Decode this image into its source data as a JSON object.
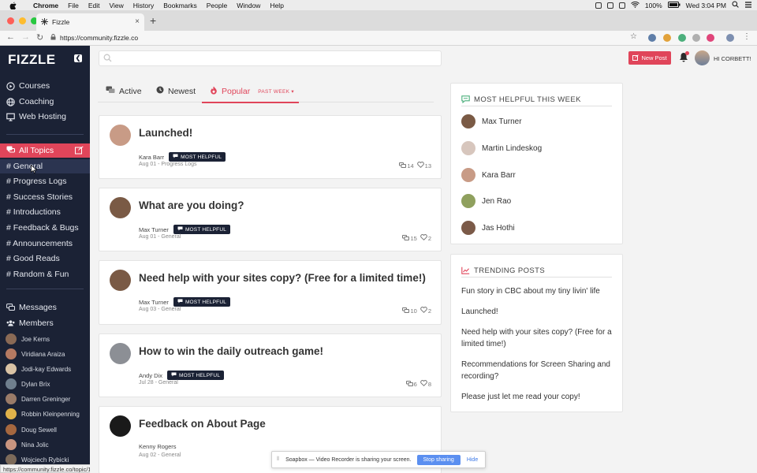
{
  "mac_menu": {
    "app": "Chrome",
    "items": [
      "File",
      "Edit",
      "View",
      "History",
      "Bookmarks",
      "People",
      "Window",
      "Help"
    ],
    "battery": "100%",
    "clock": "Wed 3:04 PM"
  },
  "browser": {
    "tab_title": "Fizzle",
    "url": "https://community.fizzle.co",
    "status_url": "https://community.fizzle.co/topic/1"
  },
  "sidebar": {
    "logo": "FIZZLE",
    "nav": [
      {
        "label": "Courses",
        "icon": "play-circle-icon"
      },
      {
        "label": "Coaching",
        "icon": "globe-icon"
      },
      {
        "label": "Web Hosting",
        "icon": "monitor-icon"
      }
    ],
    "all_topics": "All Topics",
    "topics": [
      "# General",
      "# Progress Logs",
      "# Success Stories",
      "# Introductions",
      "# Feedback & Bugs",
      "# Announcements",
      "# Good Reads",
      "# Random & Fun"
    ],
    "messages": "Messages",
    "members_label": "Members",
    "members": [
      {
        "name": "Joe Kerns",
        "color": "#8a6a55"
      },
      {
        "name": "Viridiana Araiza",
        "color": "#b57a62"
      },
      {
        "name": "Jodi-kay Edwards",
        "color": "#d9c3a5"
      },
      {
        "name": "Dylan Brix",
        "color": "#6f7f8e"
      },
      {
        "name": "Darren Greninger",
        "color": "#9a7b68"
      },
      {
        "name": "Robbin Kleinpenning",
        "color": "#e0b24a"
      },
      {
        "name": "Doug Sewell",
        "color": "#a5673f"
      },
      {
        "name": "Nina Jolic",
        "color": "#c99580"
      },
      {
        "name": "Wojciech Rybicki",
        "color": "#7c6a5a"
      }
    ]
  },
  "topbar": {
    "new_post": "New Post",
    "greeting": "HI CORBETT!"
  },
  "filters": {
    "active": "Active",
    "newest": "Newest",
    "popular": "Popular",
    "period": "PAST WEEK"
  },
  "posts": [
    {
      "title": "Launched!",
      "author": "Kara Barr",
      "badge": "MOST HELPFUL",
      "meta": "Aug 01 - Progress Logs",
      "replies": "14",
      "likes": "13",
      "avatar": "#c89b86"
    },
    {
      "title": "What are you doing?",
      "author": "Max Turner",
      "badge": "MOST HELPFUL",
      "meta": "Aug 01 - General",
      "replies": "15",
      "likes": "2",
      "avatar": "#7a5a45"
    },
    {
      "title": "Need help with your sites copy? (Free for a limited time!)",
      "author": "Max Turner",
      "badge": "MOST HELPFUL",
      "meta": "Aug 03 - General",
      "replies": "10",
      "likes": "2",
      "avatar": "#7a5a45"
    },
    {
      "title": "How to win the daily outreach game!",
      "author": "Andy Dix",
      "badge": "MOST HELPFUL",
      "meta": "Jul 28 - General",
      "replies": "6",
      "likes": "8",
      "avatar": "#8c8f95"
    },
    {
      "title": "Feedback on About Page",
      "author": "Kenny Rogers",
      "badge": "",
      "meta": "Aug 02 - General",
      "replies": "",
      "likes": "",
      "avatar": "#1a1a1a"
    }
  ],
  "most_helpful": {
    "heading": "MOST HELPFUL THIS WEEK",
    "people": [
      {
        "name": "Max Turner",
        "color": "#7a5a45"
      },
      {
        "name": "Martin Lindeskog",
        "color": "#d7c6bd"
      },
      {
        "name": "Kara Barr",
        "color": "#c89b86"
      },
      {
        "name": "Jen Rao",
        "color": "#8fa05e"
      },
      {
        "name": "Jas Hothi",
        "color": "#7b5a48"
      }
    ]
  },
  "trending": {
    "heading": "TRENDING POSTS",
    "posts": [
      "Fun story in CBC about my tiny livin' life",
      "Launched!",
      "Need help with your sites copy? (Free for a limited time!)",
      "Recommendations for Screen Sharing and recording?",
      "Please just let me read your copy!"
    ]
  },
  "share_bar": {
    "message": "Soapbox — Video Recorder is sharing your screen.",
    "stop": "Stop sharing",
    "hide": "Hide"
  }
}
